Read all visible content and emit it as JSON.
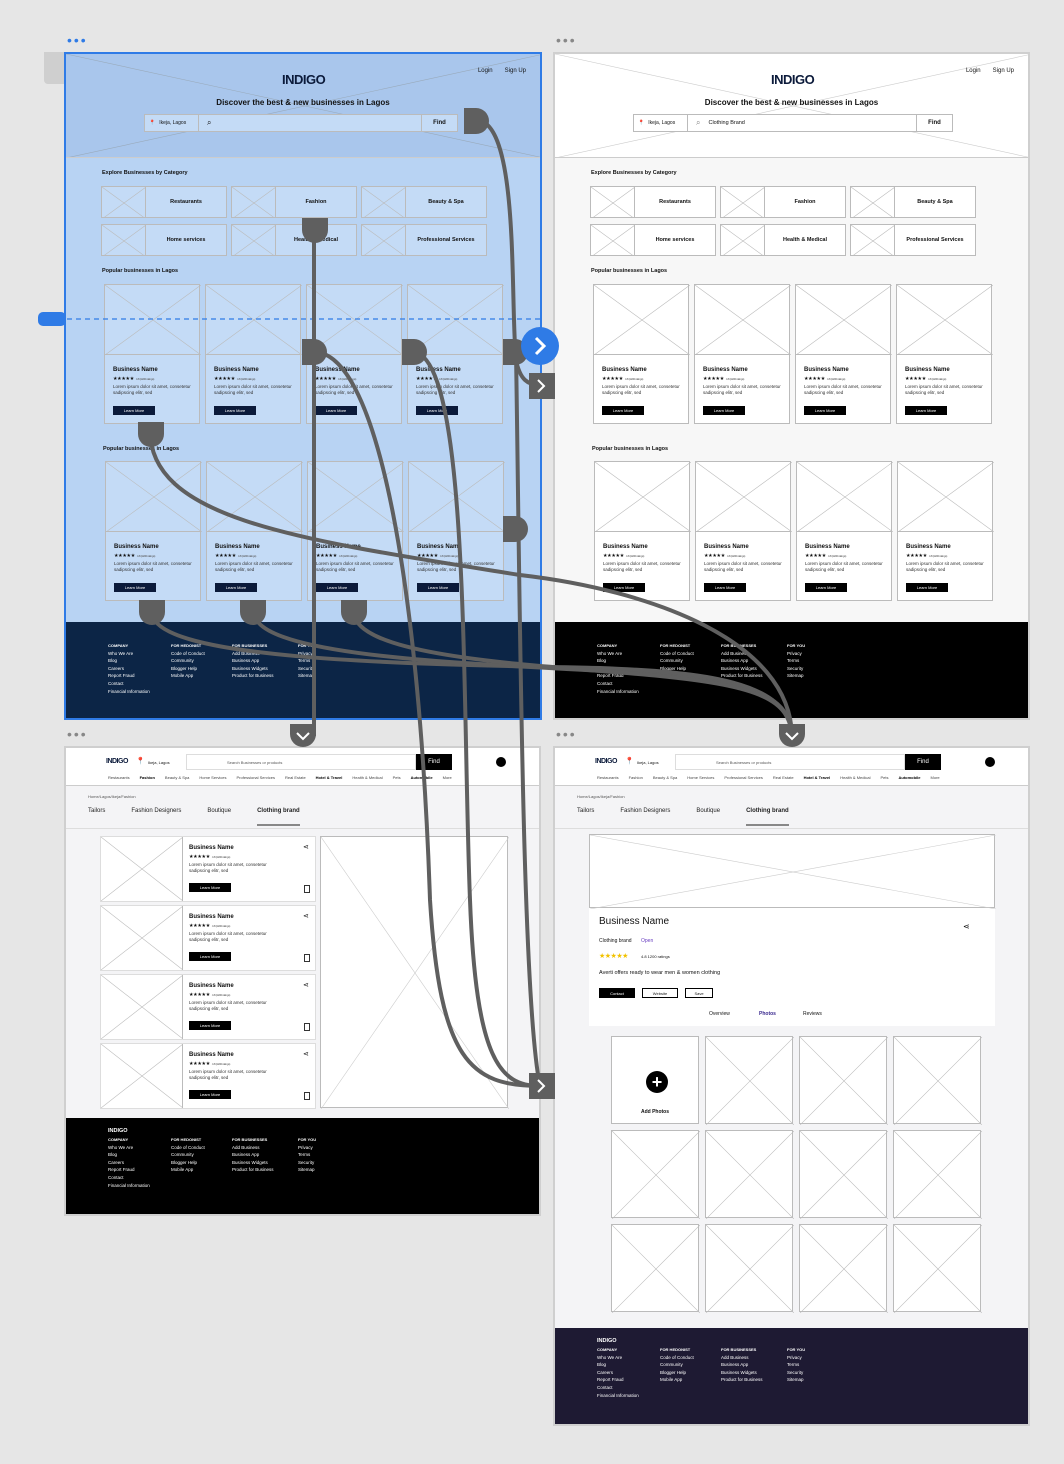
{
  "brand": "INDIGO",
  "auth": {
    "login": "Login",
    "signup": "Sign Up"
  },
  "hero": {
    "tagline": "Discover the best & new businesses in Lagos",
    "location": "Ikeja, Lagos",
    "find": "Find",
    "query_filled": "Clothing Brand"
  },
  "explore_title": "Explore Businesses by Category",
  "categories": [
    "Restaurants",
    "Fashion",
    "Beauty & Spa",
    "Home services",
    "Health & Medical",
    "Professional Services"
  ],
  "popular_title": "Popular businesses in Lagos",
  "card": {
    "name": "Business Name",
    "stars": "★★★★★",
    "ratings": "4.8 (1200 ratings)",
    "desc": "Lorem ipsum dolor sit amet, consetetur sadipscing elitr, sed",
    "cta": "Learn More"
  },
  "footer": {
    "col1": {
      "head": "COMPANY",
      "items": [
        "Who We Are",
        "Blog",
        "Careers",
        "Report Fraud",
        "Contact",
        "Financial Information"
      ]
    },
    "col2": {
      "head": "FOR HEDONIST",
      "items": [
        "Code of Conduct",
        "Community",
        "Blogger Help",
        "Mobile App"
      ]
    },
    "col3": {
      "head": "FOR BUSINESSES",
      "items": [
        "Add Business",
        "Business App",
        "Business Widgets",
        "Product for Business"
      ]
    },
    "col4": {
      "head": "FOR YOU",
      "items": [
        "Privacy",
        "Terms",
        "Security",
        "Sitemap"
      ]
    }
  },
  "listing": {
    "search_placeholder": "Search Businesses or products",
    "find": "Find",
    "nav": [
      "Restaurants",
      "Fashion",
      "Beauty & Spa",
      "Home Services",
      "Professional Services",
      "Real Estate",
      "Hotel & Travel",
      "Health & Medical",
      "Pets",
      "Automobile",
      "More"
    ],
    "breadcrumb": "Home/Lagos/Ikeja/Fashion",
    "tabs": [
      "Tailors",
      "Fashion Designers",
      "Boutique",
      "Clothing brand"
    ]
  },
  "detail": {
    "name": "Business Name",
    "type": "Clothing brand",
    "status": "Open",
    "ratings": "4.8 1200 ratings",
    "desc": "Averti offers ready to wear men & women clothing",
    "buttons": [
      "Contact",
      "Website",
      "Save"
    ],
    "tabs": [
      "Overview",
      "Photos",
      "Reviews"
    ],
    "add_photos": "Add Photos"
  },
  "colors": {
    "selected": "#2f7be6",
    "footer_navy": "#0c2546",
    "footer_black": "#000000",
    "footer_purple": "#1e1a33",
    "connector": "#5f5f5f"
  }
}
